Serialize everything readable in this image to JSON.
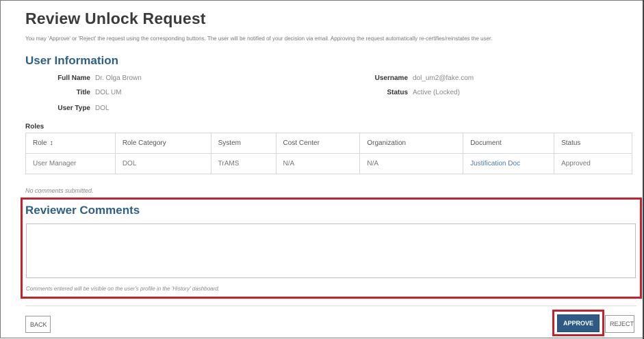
{
  "page": {
    "title": "Review Unlock Request",
    "instructions": "You may 'Approve' or 'Reject' the request using the corresponding buttons. The user will be notified of your decision via email. Approving the request automatically re-certifies/reinstates the user."
  },
  "user_info": {
    "heading": "User Information",
    "full_name_label": "Full Name",
    "full_name": "Dr. Olga Brown",
    "title_label": "Title",
    "title": "DOL UM",
    "user_type_label": "User Type",
    "user_type": "DOL",
    "username_label": "Username",
    "username": "dol_um2@fake.com",
    "status_label": "Status",
    "status": "Active (Locked)"
  },
  "roles": {
    "heading": "Roles",
    "columns": [
      "Role",
      "Role Category",
      "System",
      "Cost Center",
      "Organization",
      "Document",
      "Status"
    ],
    "sort_indicator": "↕",
    "rows": [
      [
        "User Manager",
        "DOL",
        "TrAMS",
        "N/A",
        "N/A",
        "Justification Doc",
        "Approved"
      ]
    ]
  },
  "no_comments": "No comments submitted.",
  "reviewer": {
    "heading": "Reviewer Comments",
    "value": "",
    "note": "Comments entered will be visible on the user's profile in the 'History' dashboard."
  },
  "buttons": {
    "back": "BACK",
    "approve": "APPROVE",
    "reject": "REJECT"
  },
  "colors": {
    "heading": "#2e5f86",
    "approve_bg": "#2d5b85",
    "highlight": "#c8202a",
    "link": "#4a7aa8"
  }
}
